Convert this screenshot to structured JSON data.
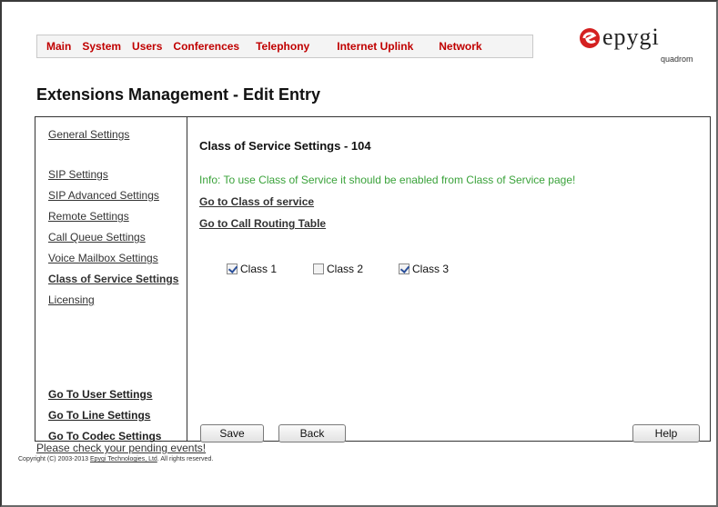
{
  "nav": [
    "Main",
    "System",
    "Users",
    "Conferences",
    "Telephony",
    "Internet Uplink",
    "Network"
  ],
  "logo": {
    "word": "epygi",
    "sub": "quadrom"
  },
  "page_title": "Extensions Management - Edit Entry",
  "sidebar": {
    "items": [
      {
        "label": "General Settings"
      },
      {
        "label": "SIP Settings"
      },
      {
        "label": "SIP Advanced Settings"
      },
      {
        "label": "Remote Settings"
      },
      {
        "label": "Call Queue Settings"
      },
      {
        "label": "Voice Mailbox Settings"
      },
      {
        "label": "Class of Service Settings"
      },
      {
        "label": "Licensing"
      }
    ],
    "bottom_links": [
      "Go To User Settings",
      "Go To Line Settings",
      "Go To Codec Settings"
    ]
  },
  "content": {
    "section_title": "Class of Service Settings - 104",
    "info": "Info: To use Class of Service it should be enabled from Class of Service page!",
    "links": [
      "Go to Class of service",
      "Go to Call Routing Table"
    ],
    "classes": [
      {
        "label": "Class 1",
        "checked": true
      },
      {
        "label": "Class 2",
        "checked": false
      },
      {
        "label": "Class 3",
        "checked": true
      }
    ]
  },
  "buttons": {
    "save": "Save",
    "back": "Back",
    "help": "Help"
  },
  "footer": {
    "pending": "Please check your pending events!",
    "copyright_prefix": "Copyright (C) 2003-2013 ",
    "copyright_link": "Epygi Technologies, Ltd",
    "copyright_suffix": ". All rights reserved."
  }
}
